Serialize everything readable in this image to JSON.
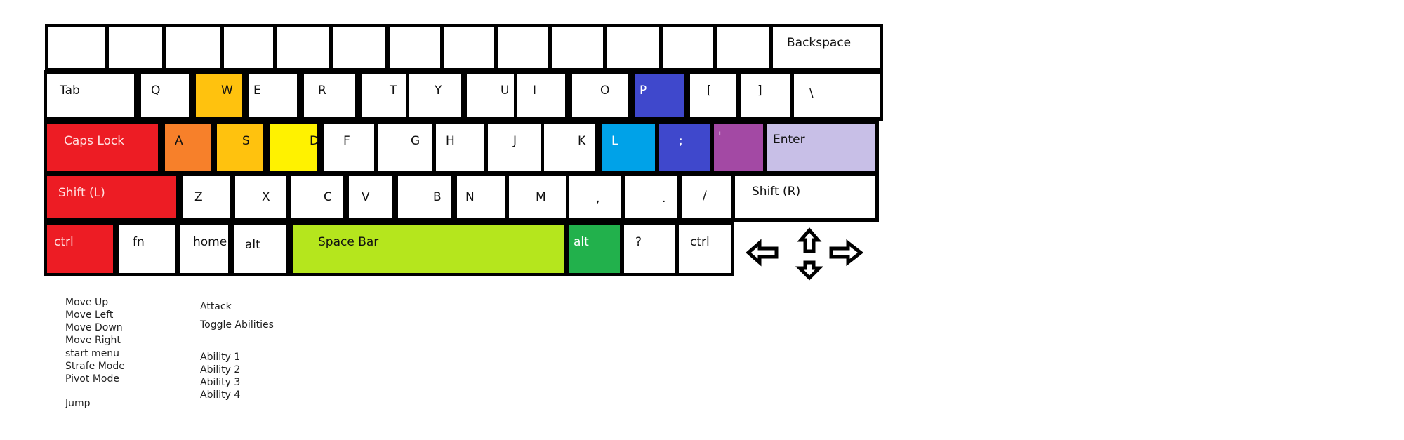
{
  "colors": {
    "up": "#ffc20e",
    "left": "#f7802a",
    "down": "#ffc20e",
    "right": "#fff200",
    "red": "#ed1c24",
    "jump": "#b5e61d",
    "attack": "#c8bfe7",
    "toggle": "#22b14c",
    "ability1": "#3f48cc",
    "ability2": "#00a2e8",
    "ability3": "#3f48cc",
    "ability4": "#a349a4",
    "white": "#ffffff"
  },
  "keys": [
    {
      "id": "num-1",
      "label": "",
      "color": "white"
    },
    {
      "id": "num-2",
      "label": "",
      "color": "white"
    },
    {
      "id": "num-3",
      "label": "",
      "color": "white"
    },
    {
      "id": "num-4",
      "label": "",
      "color": "white"
    },
    {
      "id": "num-5",
      "label": "",
      "color": "white"
    },
    {
      "id": "num-6",
      "label": "",
      "color": "white"
    },
    {
      "id": "num-7",
      "label": "",
      "color": "white"
    },
    {
      "id": "num-8",
      "label": "",
      "color": "white"
    },
    {
      "id": "num-9",
      "label": "",
      "color": "white"
    },
    {
      "id": "num-10",
      "label": "",
      "color": "white"
    },
    {
      "id": "num-11",
      "label": "",
      "color": "white"
    },
    {
      "id": "num-12",
      "label": "",
      "color": "white"
    },
    {
      "id": "num-13",
      "label": "",
      "color": "white"
    },
    {
      "id": "backspace",
      "label": "Backspace",
      "color": "white"
    },
    {
      "id": "tab",
      "label": "Tab",
      "color": "white"
    },
    {
      "id": "q",
      "label": "Q",
      "color": "white"
    },
    {
      "id": "w",
      "label": "W",
      "color": "up"
    },
    {
      "id": "e",
      "label": "E",
      "color": "white"
    },
    {
      "id": "r",
      "label": "R",
      "color": "white"
    },
    {
      "id": "t",
      "label": "T",
      "color": "white"
    },
    {
      "id": "y",
      "label": "Y",
      "color": "white"
    },
    {
      "id": "u",
      "label": "U",
      "color": "white"
    },
    {
      "id": "i",
      "label": "I",
      "color": "white"
    },
    {
      "id": "o",
      "label": "O",
      "color": "white"
    },
    {
      "id": "p",
      "label": "P",
      "color": "ability1"
    },
    {
      "id": "bracket-open",
      "label": "[",
      "color": "white"
    },
    {
      "id": "bracket-close",
      "label": "]",
      "color": "white"
    },
    {
      "id": "backslash",
      "label": "\\",
      "color": "white"
    },
    {
      "id": "caps-lock",
      "label": "Caps Lock",
      "color": "red"
    },
    {
      "id": "a",
      "label": "A",
      "color": "left"
    },
    {
      "id": "s",
      "label": "S",
      "color": "down"
    },
    {
      "id": "d",
      "label": "D",
      "color": "right"
    },
    {
      "id": "f",
      "label": "F",
      "color": "white"
    },
    {
      "id": "g",
      "label": "G",
      "color": "white"
    },
    {
      "id": "h",
      "label": "H",
      "color": "white"
    },
    {
      "id": "j",
      "label": "J",
      "color": "white"
    },
    {
      "id": "k",
      "label": "K",
      "color": "white"
    },
    {
      "id": "l",
      "label": "L",
      "color": "ability2"
    },
    {
      "id": "semicolon",
      "label": ";",
      "color": "ability3"
    },
    {
      "id": "quote",
      "label": "'",
      "color": "ability4"
    },
    {
      "id": "enter",
      "label": "Enter",
      "color": "attack"
    },
    {
      "id": "shift-left",
      "label": "Shift (L)",
      "color": "red"
    },
    {
      "id": "z",
      "label": "Z",
      "color": "white"
    },
    {
      "id": "x",
      "label": "X",
      "color": "white"
    },
    {
      "id": "c",
      "label": "C",
      "color": "white"
    },
    {
      "id": "v",
      "label": "V",
      "color": "white"
    },
    {
      "id": "b",
      "label": "B",
      "color": "white"
    },
    {
      "id": "n",
      "label": "N",
      "color": "white"
    },
    {
      "id": "m",
      "label": "M",
      "color": "white"
    },
    {
      "id": "comma",
      "label": ",",
      "color": "white"
    },
    {
      "id": "period",
      "label": ".",
      "color": "white"
    },
    {
      "id": "slash",
      "label": "/",
      "color": "white"
    },
    {
      "id": "shift-right",
      "label": "Shift (R)",
      "color": "white"
    },
    {
      "id": "ctrl-left",
      "label": "ctrl",
      "color": "red"
    },
    {
      "id": "fn",
      "label": "fn",
      "color": "white"
    },
    {
      "id": "home",
      "label": "home",
      "color": "white"
    },
    {
      "id": "alt-left",
      "label": "alt",
      "color": "white"
    },
    {
      "id": "space",
      "label": "Space  Bar",
      "color": "jump"
    },
    {
      "id": "alt-right",
      "label": "alt",
      "color": "toggle"
    },
    {
      "id": "question",
      "label": "?",
      "color": "white"
    },
    {
      "id": "ctrl-right",
      "label": "ctrl",
      "color": "white"
    }
  ],
  "legend": {
    "left_column": [
      {
        "label": "Move Up",
        "color": "up"
      },
      {
        "label": "Move Left",
        "color": "left"
      },
      {
        "label": "Move Down",
        "color": "down"
      },
      {
        "label": "Move Right",
        "color": "right"
      },
      {
        "label": "start menu",
        "color": "red"
      },
      {
        "label": "Strafe Mode",
        "color": "red"
      },
      {
        "label": "Pivot Mode",
        "color": "red"
      },
      {
        "label": "Jump",
        "color": "jump"
      }
    ],
    "right_column": [
      {
        "label": "Attack",
        "color": "attack"
      },
      {
        "label": "Toggle Abilities",
        "color": "toggle"
      },
      {
        "label": "Ability 1",
        "color": "ability1"
      },
      {
        "label": "Ability 2",
        "color": "ability2"
      },
      {
        "label": "Ability 3",
        "color": "ability3"
      },
      {
        "label": "Ability 4",
        "color": "ability4"
      }
    ]
  }
}
